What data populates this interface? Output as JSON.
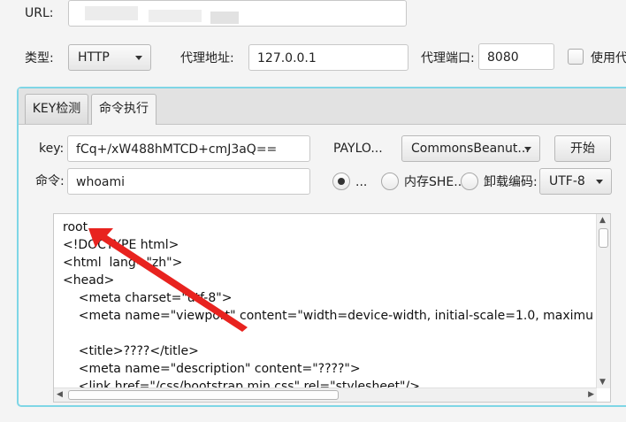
{
  "url": {
    "label": "URL:"
  },
  "proxy": {
    "type_label": "类型:",
    "type_value": "HTTP",
    "address_label": "代理地址:",
    "address_value": "127.0.0.1",
    "port_label": "代理端口:",
    "port_value": "8080",
    "use_label": "使用代"
  },
  "tabs": [
    {
      "label": "KEY检测"
    },
    {
      "label": "命令执行"
    }
  ],
  "cmd_panel": {
    "key_label": "key:",
    "key_value": "fCq+/xW488hMTCD+cmJ3aQ==",
    "payload_label": "PAYLO...",
    "payload_value": "CommonsBeanut...",
    "start_label": "开始",
    "command_label": "命令:",
    "command_value": "whoami",
    "radio1_label": "...",
    "radio2_label": "内存SHE...",
    "radio3_label": "卸载",
    "encoding_label": "编码:",
    "encoding_value": "UTF-8"
  },
  "output": {
    "lines": [
      "root",
      "<!DOCTYPE html>",
      "<html  lang=\"zh\">",
      "<head>",
      "    <meta charset=\"utf-8\">",
      "    <meta name=\"viewport\" content=\"width=device-width, initial-scale=1.0, maximu",
      "",
      "    <title>????</title>",
      "    <meta name=\"description\" content=\"????\">",
      "    <link href=\"/css/bootstrap.min.css\" rel=\"stylesheet\"/>"
    ]
  },
  "colors": {
    "accent_border": "#7fd6e6",
    "arrow": "#e8231f"
  },
  "icons": {
    "dropdown": "chevron-down-icon",
    "annotation": "red-arrow-icon"
  }
}
